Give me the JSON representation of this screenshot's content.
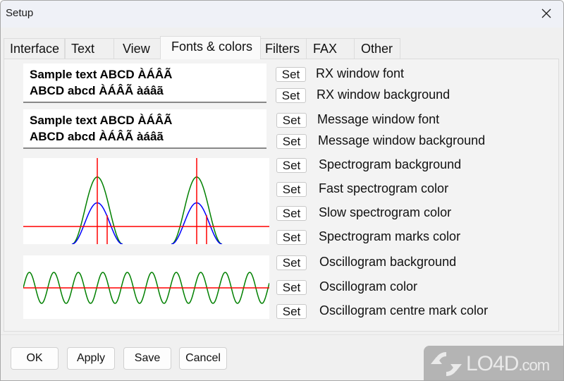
{
  "window": {
    "title": "Setup",
    "close_icon": "close-icon"
  },
  "tabs": [
    {
      "label": "Interface"
    },
    {
      "label": "Text"
    },
    {
      "label": "View"
    },
    {
      "label": "Fonts & colors",
      "active": true
    },
    {
      "label": "Filters"
    },
    {
      "label": "FAX"
    },
    {
      "label": "Other"
    }
  ],
  "samples": {
    "rx": {
      "line1": "Sample text ABCD ÀÁÂÃ",
      "line2": "ABCD abcd ÀÁÂÃ àáâã"
    },
    "message": {
      "line1": "Sample text ABCD ÀÁÂÃ",
      "line2": "ABCD abcd ÀÁÂÃ àáâã"
    }
  },
  "settings": [
    {
      "button": "Set",
      "label": "RX window font"
    },
    {
      "button": "Set",
      "label": "RX window background"
    },
    {
      "button": "Set",
      "label": "Message window font"
    },
    {
      "button": "Set",
      "label": "Message window background"
    },
    {
      "button": "Set",
      "label": "Spectrogram background"
    },
    {
      "button": "Set",
      "label": "Fast spectrogram color"
    },
    {
      "button": "Set",
      "label": "Slow spectrogram color"
    },
    {
      "button": "Set",
      "label": "Spectrogram marks color"
    },
    {
      "button": "Set",
      "label": "Oscillogram background"
    },
    {
      "button": "Set",
      "label": "Oscillogram color"
    },
    {
      "button": "Set",
      "label": "Oscillogram centre mark color"
    }
  ],
  "colors": {
    "spectrogram_background": "#ffffff",
    "fast_spectrogram": "#008000",
    "slow_spectrogram": "#0000ff",
    "spectrogram_marks": "#ff0000",
    "oscillogram_background": "#ffffff",
    "oscillogram": "#008000",
    "oscillogram_centre_mark": "#ff0000"
  },
  "preview": {
    "spectrogram_peaks": 2,
    "fast_peak_level": 0.78,
    "slow_peak_level": 0.48,
    "oscillogram_cycles": 10
  },
  "footer": {
    "ok": "OK",
    "apply": "Apply",
    "save": "Save",
    "cancel": "Cancel"
  },
  "watermark": {
    "brand": "LO4D",
    "suffix": ".com"
  }
}
